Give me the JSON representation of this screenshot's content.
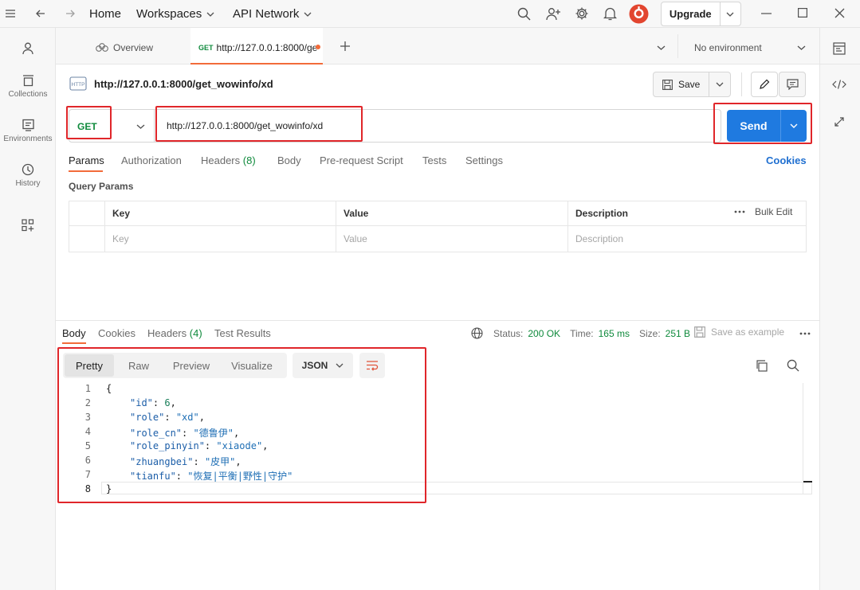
{
  "titlebar": {
    "home": "Home",
    "workspaces": "Workspaces",
    "api_network": "API Network",
    "upgrade": "Upgrade"
  },
  "sidebar": {
    "items": [
      {
        "label": ""
      },
      {
        "label": "Collections"
      },
      {
        "label": "Environments"
      },
      {
        "label": "History"
      },
      {
        "label": ""
      }
    ]
  },
  "tabs": {
    "overview": "Overview",
    "active_method": "GET",
    "active_url": "http://127.0.0.1:8000/ge",
    "environment": "No environment"
  },
  "request": {
    "title": "http://127.0.0.1:8000/get_wowinfo/xd",
    "save_label": "Save",
    "method": "GET",
    "url": "http://127.0.0.1:8000/get_wowinfo/xd",
    "send_label": "Send"
  },
  "request_tabs": {
    "params": "Params",
    "authorization": "Authorization",
    "headers": "Headers",
    "headers_count": "(8)",
    "body": "Body",
    "prerequest": "Pre-request Script",
    "tests": "Tests",
    "settings": "Settings",
    "cookies": "Cookies"
  },
  "query_params": {
    "title": "Query Params",
    "columns": [
      "Key",
      "Value",
      "Description"
    ],
    "bulk_edit": "Bulk Edit",
    "placeholders": [
      "Key",
      "Value",
      "Description"
    ]
  },
  "response": {
    "tabs": {
      "body": "Body",
      "cookies": "Cookies",
      "headers": "Headers",
      "headers_count": "(4)",
      "test_results": "Test Results"
    },
    "status_label": "Status:",
    "status_value": "200 OK",
    "time_label": "Time:",
    "time_value": "165 ms",
    "size_label": "Size:",
    "size_value": "251 B",
    "save_example": "Save as example",
    "view_tabs": [
      "Pretty",
      "Raw",
      "Preview",
      "Visualize"
    ],
    "format": "JSON",
    "line_numbers": [
      "1",
      "2",
      "3",
      "4",
      "5",
      "6",
      "7",
      "8"
    ],
    "json_lines": [
      {
        "text": "{"
      },
      {
        "key": "\"id\"",
        "value": "6",
        "type": "num"
      },
      {
        "key": "\"role\"",
        "value": "\"xd\"",
        "type": "str"
      },
      {
        "key": "\"role_cn\"",
        "value": "\"德鲁伊\"",
        "type": "str"
      },
      {
        "key": "\"role_pinyin\"",
        "value": "\"xiaode\"",
        "type": "str"
      },
      {
        "key": "\"zhuangbei\"",
        "value": "\"皮甲\"",
        "type": "str"
      },
      {
        "key": "\"tianfu\"",
        "value": "\"恢复|平衡|野性|守护\"",
        "type": "str"
      },
      {
        "text": "}"
      }
    ]
  },
  "colors": {
    "send_blue": "#1f7ae0",
    "highlight_red": "#e0262a",
    "status_green": "#0f8a3c",
    "method_green": "#0f8a3c"
  }
}
